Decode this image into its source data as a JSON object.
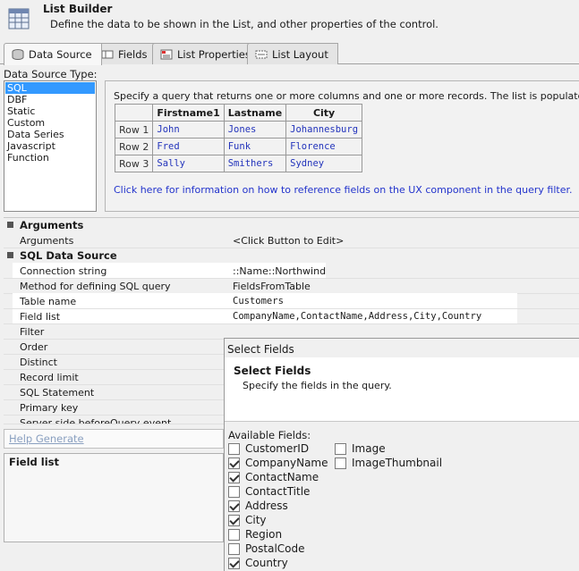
{
  "header": {
    "title": "List Builder",
    "description": "Define the data to be shown in the List, and other properties of the control.",
    "icon": "list-grid-icon"
  },
  "tabs": [
    {
      "label": "Data Source",
      "icon": "database-icon",
      "active": true
    },
    {
      "label": "Fields",
      "icon": "fields-icon",
      "active": false
    },
    {
      "label": "List Properties",
      "icon": "properties-icon",
      "active": false
    },
    {
      "label": "List Layout",
      "icon": "layout-icon",
      "active": false
    }
  ],
  "data_source": {
    "label": "Data Source Type:",
    "types": [
      "SQL",
      "DBF",
      "Static",
      "Custom",
      "Data Series",
      "Javascript Function"
    ],
    "selected": "SQL"
  },
  "info": {
    "text": "Specify a query that returns one or more columns and one or more records. The list is populated with data fr",
    "table": {
      "headers": [
        "",
        "Firstname1",
        "Lastname",
        "City"
      ],
      "rows": [
        [
          "Row 1",
          "John",
          "Jones",
          "Johannesburg"
        ],
        [
          "Row 2",
          "Fred",
          "Funk",
          "Florence"
        ],
        [
          "Row 3",
          "Sally",
          "Smithers",
          "Sydney"
        ]
      ]
    },
    "link": "Click here for information on how to reference fields on the UX component in the query filter."
  },
  "property_grid": {
    "arguments_category": "Arguments",
    "arguments_name": "Arguments",
    "arguments_value": "<Click Button to Edit>",
    "sql_category": "SQL Data Source",
    "connection_string_name": "Connection string",
    "connection_string_value": "::Name::Northwind",
    "method_name": "Method for defining SQL query",
    "method_value": "FieldsFromTable",
    "table_name_name": "Table name",
    "table_name_value": "Customers",
    "field_list_name": "Field list",
    "field_list_value": "CompanyName,ContactName,Address,City,Country",
    "filter_name": "Filter",
    "order_name": "Order",
    "distinct_name": "Distinct",
    "record_limit_name": "Record limit",
    "sql_statement_name": "SQL Statement",
    "primary_key_name": "Primary key",
    "server_side_name": "Server side beforeQuery event"
  },
  "help_generate": "Help Generate",
  "description_title": "Field list",
  "popup": {
    "title": "Select Fields",
    "heading": "Select Fields",
    "subheading": "Specify the fields in the query.",
    "available_label": "Available Fields:",
    "fields_col1": [
      {
        "name": "CustomerID",
        "checked": false
      },
      {
        "name": "CompanyName",
        "checked": true
      },
      {
        "name": "ContactName",
        "checked": true
      },
      {
        "name": "ContactTitle",
        "checked": false
      },
      {
        "name": "Address",
        "checked": true
      },
      {
        "name": "City",
        "checked": true
      },
      {
        "name": "Region",
        "checked": false
      },
      {
        "name": "PostalCode",
        "checked": false
      },
      {
        "name": "Country",
        "checked": true
      }
    ],
    "fields_col2": [
      {
        "name": "Image",
        "checked": false
      },
      {
        "name": "ImageThumbnail",
        "checked": false
      }
    ]
  }
}
